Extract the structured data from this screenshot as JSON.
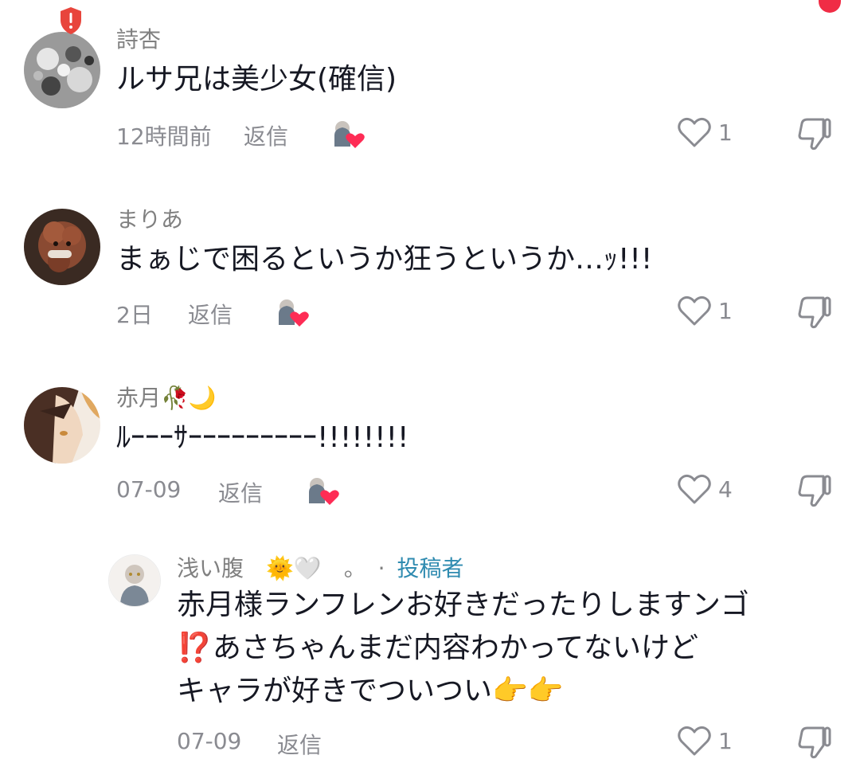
{
  "comments": [
    {
      "username": "詩杏",
      "text": "ルサ兄は美少女(確信)",
      "time": "12時間前",
      "reply": "返信",
      "likes": "1",
      "icons": {
        "like": "heart-outline-icon",
        "dislike": "thumbs-down-icon",
        "creator_like": "creator-liked-avatar-icon"
      }
    },
    {
      "username": "まりあ",
      "text": "まぁじで困るというか狂うというか…ｯ!!!",
      "time": "2日",
      "reply": "返信",
      "likes": "1"
    },
    {
      "username": "赤月🥀🌙",
      "text": "ﾙｰｰｰｻｰｰｰｰｰｰｰｰｰ!!!!!!!!",
      "time": "07-09",
      "reply": "返信",
      "likes": "4"
    }
  ],
  "reply": {
    "username": "浅い腹　🌞🤍　。",
    "dot": "·",
    "author_label": "投稿者",
    "text_lines": [
      "赤月様ランフレンお好きだったりしますンゴ",
      "⁉️あさちゃんまだ内容わかってないけど",
      "キャラが好きでついつい👉👉"
    ],
    "time": "07-09",
    "reply": "返信",
    "likes": "1"
  },
  "colors": {
    "text": "#161823",
    "muted": "#8a8b91",
    "author": "#2f8bb0",
    "heart": "#fe2c55",
    "badge": "#e8453c"
  }
}
